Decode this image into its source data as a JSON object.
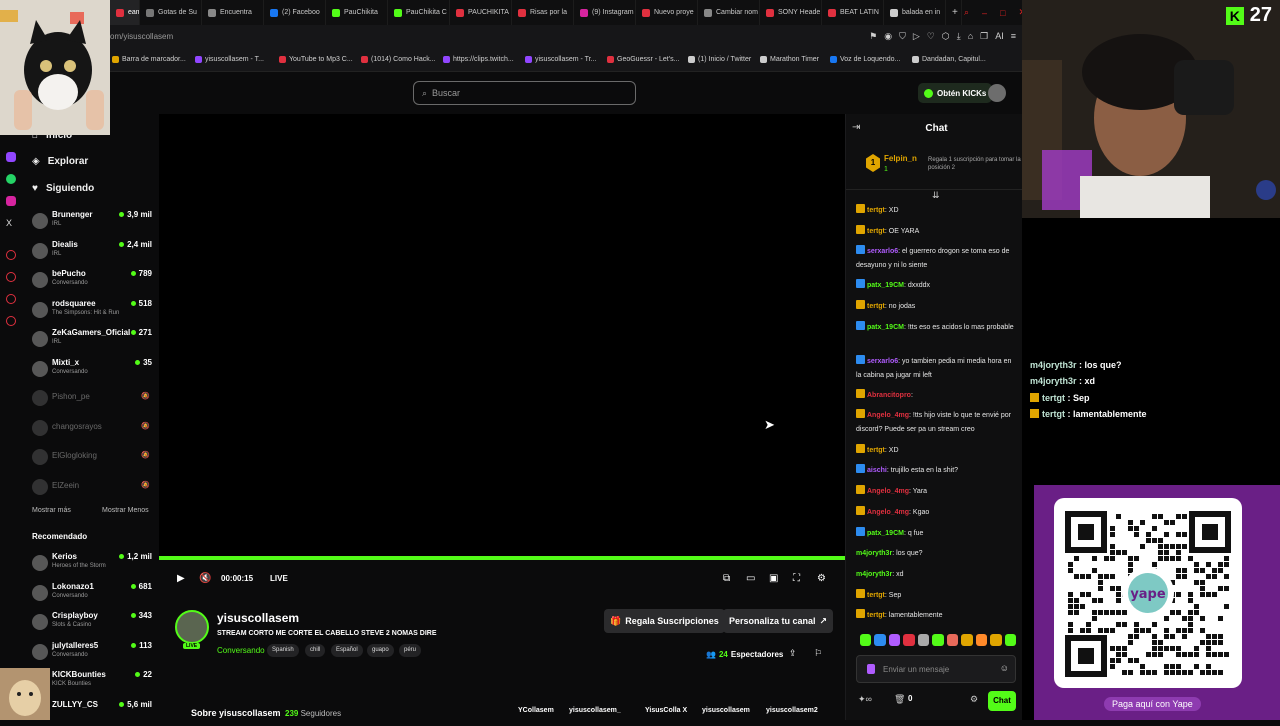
{
  "browser": {
    "tabs": [
      {
        "label": "eam",
        "color": "#e0303f",
        "active": true
      },
      {
        "label": "Gotas de Su",
        "color": "#777777"
      },
      {
        "label": "Encuentra",
        "color": "#888888"
      },
      {
        "label": "(2) Faceboo",
        "color": "#1877f2"
      },
      {
        "label": "PauChikita",
        "color": "#53fc18"
      },
      {
        "label": "PauChikita C",
        "color": "#53fc18"
      },
      {
        "label": "PAUCHIKITA",
        "color": "#e0303f"
      },
      {
        "label": "Risas por la",
        "color": "#e0303f"
      },
      {
        "label": "(9) Instagram",
        "color": "#d6249f"
      },
      {
        "label": "Nuevo proye",
        "color": "#e0303f"
      },
      {
        "label": "Cambiar nom",
        "color": "#888888"
      },
      {
        "label": "SONY Heade",
        "color": "#e0303f"
      },
      {
        "label": "BEAT LATIN",
        "color": "#e0303f"
      },
      {
        "label": "balada en in",
        "color": "#cccccc"
      }
    ],
    "url": "om/yisuscollasem",
    "bookmarks": [
      {
        "label": "Barra de marcador...",
        "color": "#e0a500"
      },
      {
        "label": "yisuscollasem - T...",
        "color": "#9146ff"
      },
      {
        "label": "YouTube to Mp3 C...",
        "color": "#e0303f"
      },
      {
        "label": "(1014) Como Hack...",
        "color": "#e0303f"
      },
      {
        "label": "https://clips.twitch...",
        "color": "#9146ff"
      },
      {
        "label": "yisuscollasem - Tr...",
        "color": "#9146ff"
      },
      {
        "label": "GeoGuessr - Let's...",
        "color": "#e0303f"
      },
      {
        "label": "(1) Inicio / Twitter",
        "color": "#cccccc"
      },
      {
        "label": "Marathon Timer",
        "color": "#cccccc"
      },
      {
        "label": "Voz de Loquendo...",
        "color": "#1877f2"
      },
      {
        "label": "Dandadan, Capitul...",
        "color": "#cccccc"
      }
    ]
  },
  "header": {
    "search_placeholder": "Buscar",
    "kicks_button": "Obtén KICKs"
  },
  "sidebar": {
    "nav": [
      {
        "label": "Inicio"
      },
      {
        "label": "Explorar"
      },
      {
        "label": "Siguiendo"
      }
    ],
    "following": [
      {
        "name": "Brunenger",
        "category": "IRL",
        "viewers": "3,9 mil",
        "live": true
      },
      {
        "name": "Diealis",
        "category": "IRL",
        "viewers": "2,4 mil",
        "live": true
      },
      {
        "name": "bePucho",
        "category": "Conversando",
        "viewers": "789",
        "live": true
      },
      {
        "name": "rodsquaree",
        "category": "The Simpsons: Hit & Run",
        "viewers": "518",
        "live": true
      },
      {
        "name": "ZeKaGamers_Oficial",
        "category": "IRL",
        "viewers": "271",
        "live": true
      },
      {
        "name": "Mixti_x",
        "category": "Conversando",
        "viewers": "35",
        "live": true
      },
      {
        "name": "Pishon_pe",
        "live": false
      },
      {
        "name": "changosrayos",
        "live": false
      },
      {
        "name": "ElGlogloking",
        "live": false
      },
      {
        "name": "ElZeein",
        "live": false
      }
    ],
    "show_more": "Mostrar más",
    "show_less": "Mostrar Menos",
    "recommended_title": "Recomendado",
    "recommended": [
      {
        "name": "Kerios",
        "category": "Heroes of the Storm",
        "viewers": "1,2 mil"
      },
      {
        "name": "Lokonazo1",
        "category": "Conversando",
        "viewers": "681"
      },
      {
        "name": "Crisplayboy",
        "category": "Slots & Casino",
        "viewers": "343"
      },
      {
        "name": "julytalleres5",
        "category": "Conversando",
        "viewers": "113"
      },
      {
        "name": "KICKBounties",
        "category": "KICK Bounties",
        "viewers": "22"
      },
      {
        "name": "ZULLYY_CS",
        "category": "",
        "viewers": "5,6 mil"
      }
    ]
  },
  "player": {
    "time": "00:00:15",
    "live_label": "LIVE"
  },
  "stream": {
    "streamer": "yisuscollasem",
    "live_badge": "LIVE",
    "title": "STREAM CORTO ME CORTE EL CABELLO STEVE 2 NOMAS DIRE",
    "category": "Conversando",
    "tags": [
      "Spanish",
      "chill",
      "Español",
      "guapo",
      "péru"
    ],
    "gift_button": "Regala Suscripciones",
    "customize_button": "Personaliza tu canal",
    "viewers": "24",
    "viewers_label": "Espectadores",
    "about_label": "Sobre yisuscollasem",
    "followers_count": "239",
    "followers_label": "Seguidores",
    "socials": [
      "YCollasem",
      "yisuscollasem_",
      "YisusColla X",
      "yisuscollasem",
      "yisuscollasem2"
    ]
  },
  "chat": {
    "title": "Chat",
    "pinned": {
      "rank": "1",
      "user": "Felpin_n",
      "count": "1",
      "gift_text": "Regala 1 suscripción para tomar la posición 2"
    },
    "messages": [
      {
        "user": "tertgt",
        "color": "#e0a500",
        "badge": "#e0a500",
        "text": "XD"
      },
      {
        "user": "tertgt",
        "color": "#e0a500",
        "badge": "#e0a500",
        "text": "OE YARA"
      },
      {
        "user": "serxarlo6",
        "color": "#b05cff",
        "badge": "#2d8cf0",
        "text": "el guerrero drogon se toma eso de desayuno y ni lo siente"
      },
      {
        "user": "patx_19CM",
        "color": "#53fc18",
        "badge": "#2d8cf0",
        "text": "dxxddx"
      },
      {
        "user": "tertgt",
        "color": "#e0a500",
        "badge": "#e0a500",
        "text": "no jodas"
      },
      {
        "user": "patx_19CM",
        "color": "#53fc18",
        "badge": "#2d8cf0",
        "text": "!tts eso es acidos lo mas probable"
      },
      {
        "user": "serxarlo6",
        "color": "#b05cff",
        "badge": "#2d8cf0",
        "text": "yo tambien pedia mi media hora en la cabina pa jugar mi left"
      },
      {
        "user": "Abrancitopro",
        "color": "#e0303f",
        "badge": "#e0a500",
        "text": ""
      },
      {
        "user": "Angelo_4mg",
        "color": "#e0303f",
        "badge": "#e0a500",
        "text": "!tts hijo viste lo que te envié por discord? Puede ser pa un stream creo"
      },
      {
        "user": "tertgt",
        "color": "#e0a500",
        "badge": "#e0a500",
        "text": "XD"
      },
      {
        "user": "aischi",
        "color": "#b05cff",
        "badge": "#2d8cf0",
        "text": "trujillo esta en la shit?"
      },
      {
        "user": "Angelo_4mg",
        "color": "#e0303f",
        "badge": "#e0a500",
        "text": "Yara"
      },
      {
        "user": "Angelo_4mg",
        "color": "#e0303f",
        "badge": "#e0a500",
        "text": "Kgao"
      },
      {
        "user": "patx_19CM",
        "color": "#53fc18",
        "badge": "#2d8cf0",
        "text": "q fue"
      },
      {
        "user": "m4joryth3r",
        "color": "#53fc18",
        "badge": "",
        "text": "los que?"
      },
      {
        "user": "m4joryth3r",
        "color": "#53fc18",
        "badge": "",
        "text": "xd"
      },
      {
        "user": "tertgt",
        "color": "#e0a500",
        "badge": "#e0a500",
        "text": "Sep"
      },
      {
        "user": "tertgt",
        "color": "#e0a500",
        "badge": "#e0a500",
        "text": "lamentablemente"
      }
    ],
    "input_placeholder": "Enviar un mensaje",
    "points": "0",
    "send_label": "Chat"
  },
  "overlay": {
    "kick_count": "27",
    "messages": [
      {
        "user": "m4joryth3r",
        "text": "los que?"
      },
      {
        "user": "m4joryth3r",
        "text": "xd"
      },
      {
        "user": "tertgt",
        "text": "Sep"
      },
      {
        "user": "tertgt",
        "text": "lamentablemente"
      }
    ],
    "yape_brand": "yape",
    "yape_caption": "Paga aquí con Yape"
  }
}
